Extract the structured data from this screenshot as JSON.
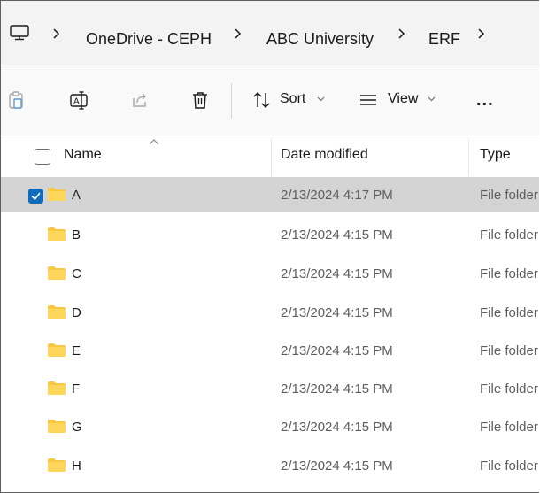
{
  "breadcrumb": {
    "items": [
      "OneDrive - CEPH",
      "ABC University",
      "ERF"
    ]
  },
  "toolbar": {
    "sort_label": "Sort",
    "view_label": "View",
    "more_label": "..."
  },
  "columns": {
    "name": "Name",
    "date_modified": "Date modified",
    "type": "Type"
  },
  "files": [
    {
      "name": "A",
      "date": "2/13/2024 4:17 PM",
      "type": "File folder",
      "selected": true
    },
    {
      "name": "B",
      "date": "2/13/2024 4:15 PM",
      "type": "File folder",
      "selected": false
    },
    {
      "name": "C",
      "date": "2/13/2024 4:15 PM",
      "type": "File folder",
      "selected": false
    },
    {
      "name": "D",
      "date": "2/13/2024 4:15 PM",
      "type": "File folder",
      "selected": false
    },
    {
      "name": "E",
      "date": "2/13/2024 4:15 PM",
      "type": "File folder",
      "selected": false
    },
    {
      "name": "F",
      "date": "2/13/2024 4:15 PM",
      "type": "File folder",
      "selected": false
    },
    {
      "name": "G",
      "date": "2/13/2024 4:15 PM",
      "type": "File folder",
      "selected": false
    },
    {
      "name": "H",
      "date": "2/13/2024 4:15 PM",
      "type": "File folder",
      "selected": false
    }
  ],
  "colors": {
    "accent": "#0f6cbd",
    "selection": "#d4d4d4",
    "folder": "#f8c842"
  },
  "icons": [
    "computer-icon",
    "chevron-right-icon",
    "paste-icon",
    "rename-icon",
    "share-icon",
    "delete-icon",
    "sort-icon",
    "view-icon",
    "chevron-down-icon",
    "more-icon",
    "folder-icon",
    "checkbox-icon"
  ]
}
